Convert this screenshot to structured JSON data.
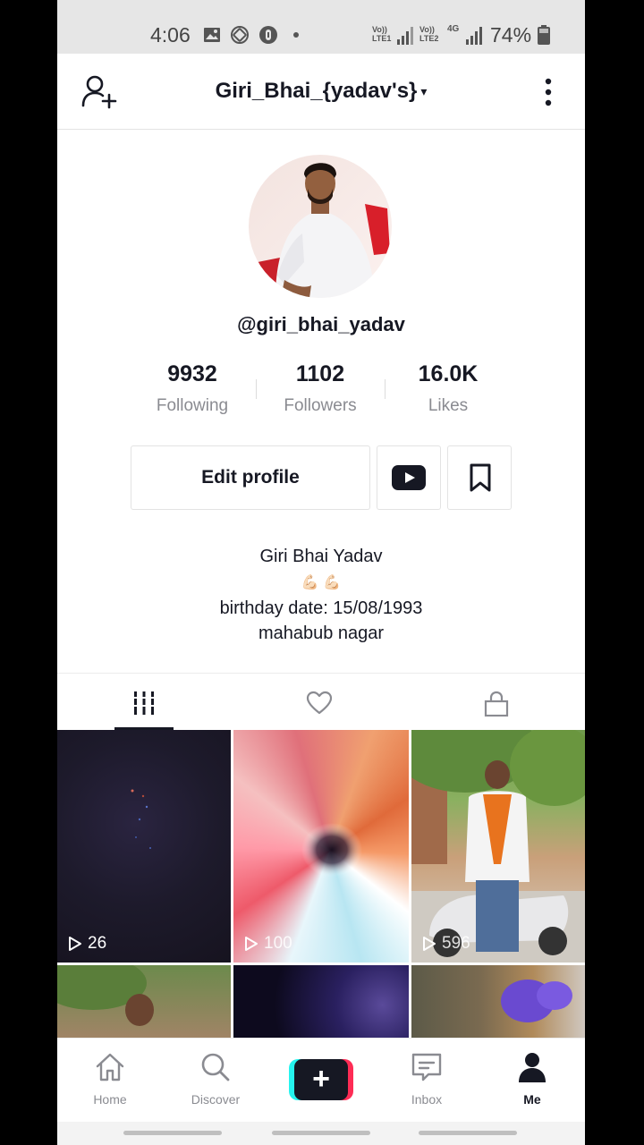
{
  "status_bar": {
    "time": "4:06",
    "net1": "Vo))\nLTE1",
    "net2": "Vo))\nLTE2",
    "net3": "4G",
    "battery": "74%",
    "icons": [
      "gallery-icon",
      "rotation-lock-icon",
      "data-saver-icon",
      "dot-icon",
      "signal-icon",
      "battery-icon"
    ]
  },
  "header": {
    "title": "Giri_Bhai_{yadav's}",
    "caret": "▾"
  },
  "profile": {
    "username": "@giri_bhai_yadav",
    "stats": [
      {
        "value": "9932",
        "label": "Following"
      },
      {
        "value": "1102",
        "label": "Followers"
      },
      {
        "value": "16.0K",
        "label": "Likes"
      }
    ],
    "edit_label": "Edit profile",
    "bio": {
      "name": "Giri Bhai Yadav",
      "emojis": "💪🏻 💪🏻",
      "line2": "birthday date: 15/08/1993",
      "line3": "mahabub nagar"
    }
  },
  "tabs": [
    {
      "icon": "videos-grid-icon",
      "active": true
    },
    {
      "icon": "heart-icon",
      "active": false
    },
    {
      "icon": "lock-icon",
      "active": false
    }
  ],
  "videos": [
    {
      "plays": "26"
    },
    {
      "plays": "100"
    },
    {
      "plays": "596"
    },
    {
      "plays": ""
    },
    {
      "plays": ""
    },
    {
      "plays": ""
    }
  ],
  "bottom_nav": {
    "items": [
      {
        "label": "Home",
        "icon": "home-icon"
      },
      {
        "label": "Discover",
        "icon": "search-icon"
      },
      {
        "label": "",
        "icon": "plus-icon"
      },
      {
        "label": "Inbox",
        "icon": "inbox-icon"
      },
      {
        "label": "Me",
        "icon": "person-icon"
      }
    ]
  },
  "colors": {
    "text": "#161823",
    "muted": "#8a8b91",
    "cyan": "#25f4ee",
    "pink": "#fe2c55"
  }
}
